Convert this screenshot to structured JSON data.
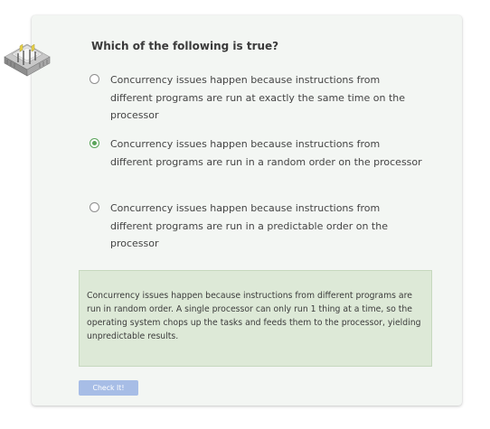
{
  "quiz": {
    "question": "Which of the following is true?",
    "options": [
      {
        "text": "Concurrency issues happen because instructions from different programs are run at exactly the same time on the processor",
        "selected": false
      },
      {
        "text": "Concurrency issues happen because instructions from different programs are run in a random order on the processor",
        "selected": true
      },
      {
        "text": "Concurrency issues happen because instructions from different programs are run in a predictable order on the processor",
        "selected": false
      }
    ],
    "feedback": "Concurrency issues happen because instructions from different programs are run in random order. A single processor can only run 1 thing at a time, so the operating system chops up the tasks and feeds them to the processor, yielding unpredictable results.",
    "check_button_label": "Check It!",
    "icon": "computer-chip-icon"
  },
  "colors": {
    "card_background": "#f3f6f3",
    "feedback_background": "#dde9d7",
    "selected_radio": "#5aa45a",
    "button_background": "#a7bde6"
  }
}
